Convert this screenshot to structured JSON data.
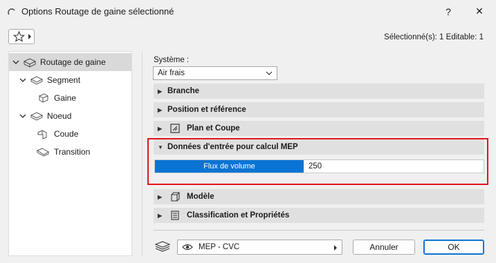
{
  "window": {
    "title": "Options Routage de gaine sélectionné",
    "help_label": "?",
    "close_label": "✕"
  },
  "toolbar": {
    "selection_info": "Sélectionné(s): 1 Editable: 1"
  },
  "tree": {
    "items": [
      {
        "label": "Routage de gaine",
        "icon": "duct-routing-icon",
        "selected": true
      },
      {
        "label": "Segment",
        "icon": "segment-icon"
      },
      {
        "label": "Gaine",
        "icon": "duct-icon"
      },
      {
        "label": "Noeud",
        "icon": "node-icon"
      },
      {
        "label": "Coude",
        "icon": "elbow-icon"
      },
      {
        "label": "Transition",
        "icon": "transition-icon"
      }
    ]
  },
  "system": {
    "label": "Système :",
    "value": "Air frais"
  },
  "sections": [
    {
      "label": "Branche",
      "expanded": false
    },
    {
      "label": "Position et référence",
      "expanded": false
    },
    {
      "label": "Plan et Coupe",
      "expanded": false,
      "icon": "floor-plan-icon"
    },
    {
      "label": "Données d'entrée pour calcul MEP",
      "expanded": true
    },
    {
      "label": "Modèle",
      "expanded": false,
      "icon": "model-icon"
    },
    {
      "label": "Classification et Propriétés",
      "expanded": false,
      "icon": "classification-icon"
    }
  ],
  "mep_input": {
    "name": "Flux de volume",
    "value": "250"
  },
  "footer": {
    "layer": "MEP - CVC",
    "cancel_label": "Annuler",
    "ok_label": "OK"
  },
  "colors": {
    "accent": "#0a74d4",
    "highlight_border": "#e3141c"
  }
}
